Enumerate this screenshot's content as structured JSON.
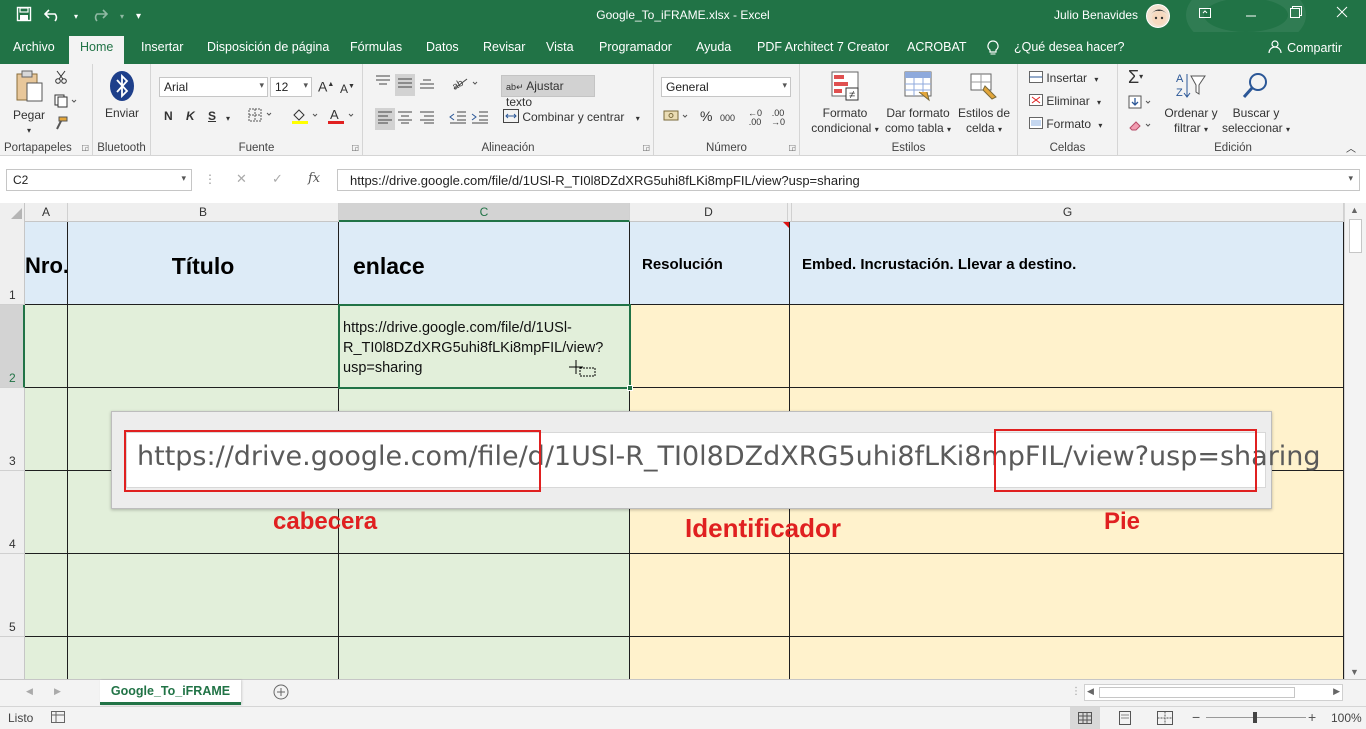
{
  "window": {
    "title": "Google_To_iFRAME.xlsx  -  Excel",
    "user": "Julio Benavides",
    "controls": [
      "restore-ribbon",
      "minimize",
      "maximize",
      "close"
    ]
  },
  "menu": {
    "tabs": [
      "Archivo",
      "Home",
      "Insertar",
      "Disposición de página",
      "Fórmulas",
      "Datos",
      "Revisar",
      "Vista",
      "Programador",
      "Ayuda",
      "PDF Architect 7 Creator",
      "ACROBAT"
    ],
    "active": "Home",
    "search": "¿Qué desea hacer?",
    "share": "Compartir"
  },
  "ribbon": {
    "clipboard": {
      "paste": "Pegar",
      "label": "Portapapeles"
    },
    "bluetooth": {
      "send": "Enviar",
      "label": "Bluetooth"
    },
    "font": {
      "name": "Arial",
      "size": "12",
      "bold": "N",
      "italic": "K",
      "underline": "S",
      "label": "Fuente"
    },
    "alignment": {
      "wrap": "Ajustar texto",
      "merge": "Combinar y centrar",
      "label": "Alineación"
    },
    "number": {
      "format": "General",
      "percent": "%",
      "thousands": "000",
      "label": "Número"
    },
    "styles": {
      "conditional_1": "Formato",
      "conditional_2": "condicional",
      "table_1": "Dar formato",
      "table_2": "como tabla",
      "cell_1": "Estilos de",
      "cell_2": "celda",
      "label": "Estilos"
    },
    "cells": {
      "insert": "Insertar",
      "delete": "Eliminar",
      "format": "Formato",
      "label": "Celdas"
    },
    "editing": {
      "sort_1": "Ordenar y",
      "sort_2": "filtrar",
      "find_1": "Buscar y",
      "find_2": "seleccionar",
      "label": "Edición"
    }
  },
  "formula_bar": {
    "name_box": "C2",
    "fx": "fx",
    "formula": "https://drive.google.com/file/d/1USl-R_TI0l8DZdXRG5uhi8fLKi8mpFIL/view?usp=sharing"
  },
  "grid": {
    "columns": [
      "A",
      "B",
      "C",
      "D",
      "G"
    ],
    "selected_column": "C",
    "rows": [
      "1",
      "2",
      "3",
      "4",
      "5"
    ],
    "selected_row": "2",
    "header_row": {
      "A": "Nro.",
      "B": "Título",
      "C": "enlace",
      "D": "Resolución",
      "G": "Embed. Incrustación. Llevar a destino."
    },
    "c2_lines": [
      "https://drive.google.com/file/d/1USl-",
      "R_TI0l8DZdXRG5uhi8fLKi8mpFIL/view?",
      "usp=sharing"
    ]
  },
  "annotation": {
    "url_header": "https://drive.google.com/file/d/",
    "url_id": "1USl-R_TI0l8DZdXRG5uhi8fLKi8mpFIL",
    "url_footer": "/view?usp=sharing",
    "label_header": "cabecera",
    "label_id": "Identificador",
    "label_footer": "Pie",
    "highlight_color": "#e02020"
  },
  "sheets": {
    "active": "Google_To_iFRAME"
  },
  "status": {
    "ready": "Listo",
    "zoom": "100%"
  },
  "colors": {
    "excel_green": "#217346",
    "header_fill": "#ddebf7",
    "green_fill": "#e2efda",
    "yellow_fill": "#fff2cc"
  }
}
